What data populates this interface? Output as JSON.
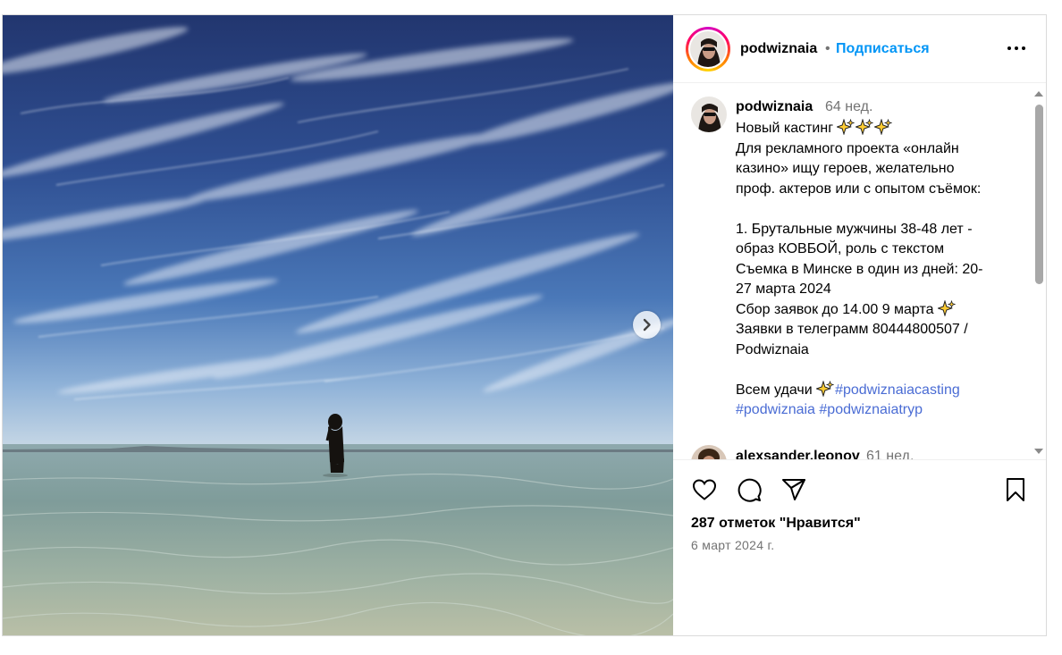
{
  "header": {
    "username": "podwiznaia",
    "separator": "•",
    "follow_label": "Подписаться"
  },
  "caption": {
    "username": "podwiznaia",
    "time": "64 нед.",
    "lines": {
      "l1": "Новый кастинг",
      "l2": "Для рекламного проекта «онлайн",
      "l3": "казино» ищу героев, желательно",
      "l4": "проф. актеров или с опытом съёмок:",
      "l5": "1. Брутальные мужчины 38-48 лет -",
      "l6": "образ КОВБОЙ, роль с текстом",
      "l7": "Съемка в Минске в один из дней: 20-",
      "l8": "27 марта 2024",
      "l9": "Сбор заявок до 14.00 9 марта",
      "l10": "Заявки в телеграмм 80444800507 /",
      "l11": "Podwiznaia",
      "l12": "Всем удачи"
    },
    "hashtags": {
      "h1": "#podwiznaiacasting",
      "h2": "#podwiznaia",
      "h3": "#podwiznaiatryp"
    }
  },
  "comment2": {
    "username": "alexsander.leonov",
    "time": "61 нед."
  },
  "likes_text": "287 отметок \"Нравится\"",
  "date": "6 март 2024 г.",
  "icons": {
    "more": "more-horizontal-icon",
    "next": "chevron-right-icon",
    "like": "heart-icon",
    "comment": "comment-bubble-icon",
    "share": "paper-plane-icon",
    "save": "bookmark-icon",
    "emoji": "sparkles-icon"
  },
  "colors": {
    "follow": "#0095f6",
    "hashtag": "#4a6cd4",
    "muted": "#737373",
    "ring": "#ff0069"
  }
}
